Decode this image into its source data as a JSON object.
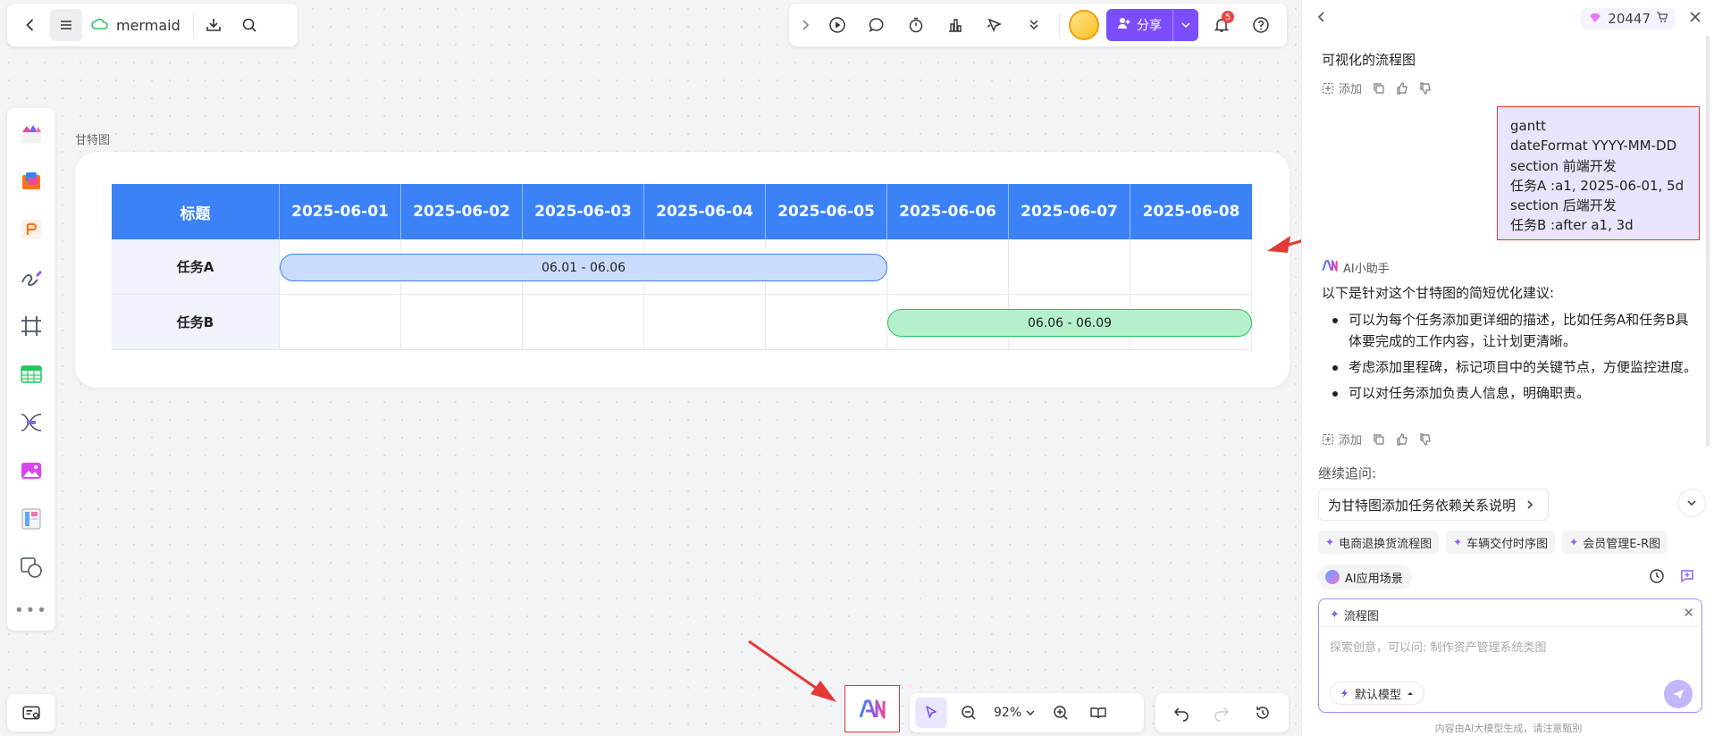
{
  "app": {
    "doc_title": "mermaid"
  },
  "topbar": {
    "share_label": "分享",
    "notification_count": "5"
  },
  "canvas": {
    "chart_caption": "甘特图",
    "gantt": {
      "header_first": "标题",
      "dates": [
        "2025-06-01",
        "2025-06-02",
        "2025-06-03",
        "2025-06-04",
        "2025-06-05",
        "2025-06-06",
        "2025-06-07",
        "2025-06-08"
      ],
      "rows": [
        {
          "task": "任务A",
          "bar_label": "06.01 - 06.06",
          "start": "2025-06-01",
          "end": "2025-06-06",
          "color": "#c9dcfb"
        },
        {
          "task": "任务B",
          "bar_label": "06.06 - 06.09",
          "start": "2025-06-06",
          "end": "2025-06-09",
          "color": "#b5f0cd"
        }
      ],
      "header_color": "#3b82f6"
    }
  },
  "bottombar": {
    "zoom": "92%"
  },
  "ai_panel": {
    "credits": "20447",
    "prev_message_tail": "可视化的流程图",
    "add_label": "添加",
    "code_lines": [
      "gantt",
      "dateFormat YYYY-MM-DD",
      "section 前端开发",
      "任务A :a1, 2025-06-01, 5d",
      "section 后端开发",
      "任务B :after a1, 3d"
    ],
    "assistant_name": "AI小助手",
    "reply_intro": "以下是针对这个甘特图的简短优化建议:",
    "reply_items": [
      "可以为每个任务添加更详细的描述，比如任务A和任务B具体要完成的工作内容，让计划更清晰。",
      "考虑添加里程碑，标记项目中的关键节点，方便监控进度。",
      "可以对任务添加负责人信息，明确职责。"
    ],
    "followup_label": "继续追问:",
    "followup_chip": "为甘特图添加任务依赖关系说明",
    "suggestions": [
      "电商退换货流程图",
      "车辆交付时序图",
      "会员管理E-R图"
    ],
    "scenario_label": "AI应用场景",
    "input_tag": "流程图",
    "input_placeholder": "探索创意，可以问: 制作资产管理系统类图",
    "model_label": "默认模型",
    "disclaimer": "内容由AI大模型生成，请注意甄别",
    "accent_color": "#7c4dff"
  }
}
